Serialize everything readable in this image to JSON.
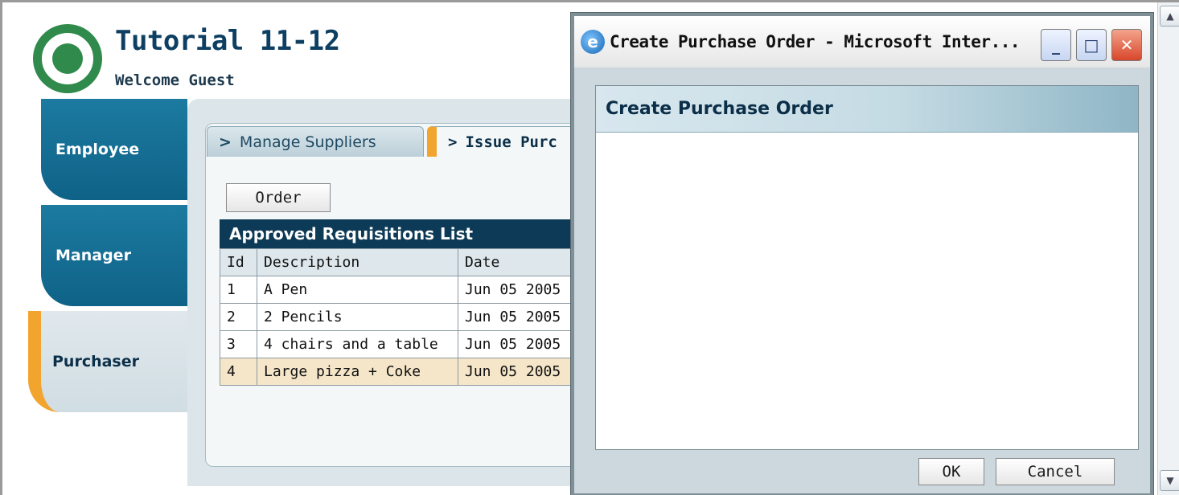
{
  "app": {
    "title": "Tutorial 11-12",
    "welcome": "Welcome Guest"
  },
  "roles": [
    {
      "label": "Employee"
    },
    {
      "label": "Manager"
    },
    {
      "label": "Purchaser"
    }
  ],
  "subtabs": [
    {
      "label": "Manage Suppliers"
    },
    {
      "label": "Issue Purc"
    }
  ],
  "actions": {
    "order_label": "Order"
  },
  "grid": {
    "title": "Approved Requisitions List",
    "headers": [
      "Id",
      "Description",
      "Date"
    ],
    "rows": [
      {
        "id": "1",
        "description": "A Pen",
        "date": "Jun 05 2005"
      },
      {
        "id": "2",
        "description": "2 Pencils",
        "date": "Jun 05 2005"
      },
      {
        "id": "3",
        "description": "4 chairs and a table",
        "date": "Jun 05 2005"
      },
      {
        "id": "4",
        "description": "Large pizza + Coke",
        "date": "Jun 05 2005"
      }
    ]
  },
  "popup": {
    "window_title": "Create Purchase Order - Microsoft Inter...",
    "panel_title": "Create Purchase Order",
    "ok_label": "OK",
    "cancel_label": "Cancel"
  },
  "colors": {
    "accent": "#f1a52f",
    "role_tab": "#0f6287",
    "header_dark": "#0d3a57"
  }
}
